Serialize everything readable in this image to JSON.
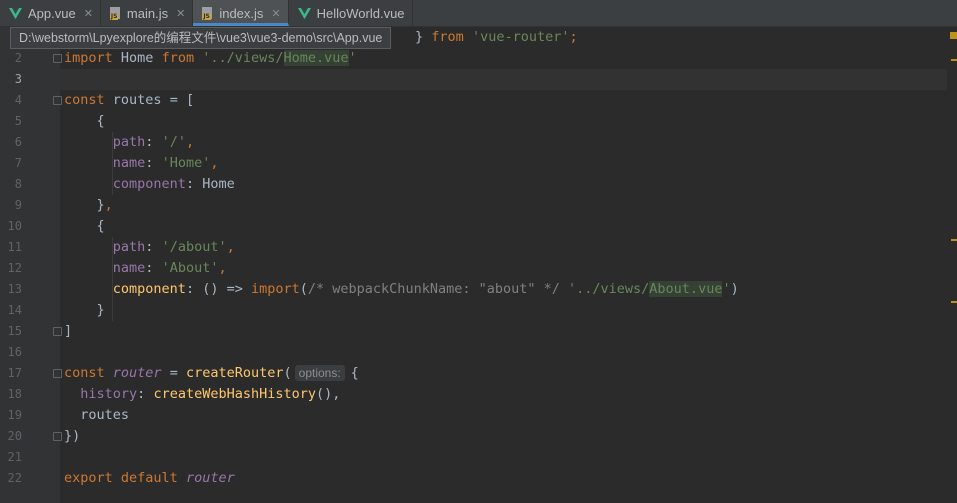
{
  "tabs": [
    {
      "label": "App.vue",
      "icon": "vue-icon"
    },
    {
      "label": "main.js",
      "icon": "js-file-icon"
    },
    {
      "label": "index.js",
      "icon": "js-file-icon",
      "active": true
    },
    {
      "label": "HelloWorld.vue",
      "icon": "vue-icon"
    }
  ],
  "js_badge": "JS",
  "tooltip": "D:\\webstorm\\Lpyexplore的编程文件\\vue3\\vue3-demo\\src\\App.vue",
  "editor": {
    "current_line": 3,
    "inlay_hint": "options:",
    "line_numbers": [
      "2",
      "3",
      "4",
      "5",
      "6",
      "7",
      "8",
      "9",
      "10",
      "11",
      "12",
      "13",
      "14",
      "15",
      "16",
      "17",
      "18",
      "19",
      "20",
      "21",
      "22"
    ],
    "lines": {
      "l1": {
        "brace": "}",
        "from": "from",
        "str": "'vue-router'",
        "semi": ";"
      },
      "l2": {
        "import": "import",
        "name": "Home",
        "from": "from",
        "str_a": "'../views/",
        "str_b": "Home.vue",
        "str_c": "'"
      },
      "l4": {
        "const": "const",
        "name": "routes",
        "rest": " = ["
      },
      "l5": {
        "text": "{"
      },
      "l6": {
        "key": "path",
        "colon": ": ",
        "str": "'/'",
        "comma": ","
      },
      "l7": {
        "key": "name",
        "colon": ": ",
        "str": "'Home'",
        "comma": ","
      },
      "l8": {
        "key": "component",
        "colon": ": ",
        "value": "Home"
      },
      "l9": {
        "brace": "}",
        "comma": ","
      },
      "l10": {
        "text": "{"
      },
      "l11": {
        "key": "path",
        "colon": ": ",
        "str": "'/about'",
        "comma": ","
      },
      "l12": {
        "key": "name",
        "colon": ": ",
        "str": "'About'",
        "comma": ","
      },
      "l13": {
        "key": "component",
        "colon": ": ",
        "arrow": "() => ",
        "import": "import",
        "paren": "(",
        "comment": "/* webpackChunkName: \"about\" */",
        "str_a": "'../views/",
        "str_b": "About.vue",
        "str_c": "'",
        "close": ")"
      },
      "l14": {
        "text": "}"
      },
      "l15": {
        "text": "]"
      },
      "l17": {
        "const": "const",
        "name": "router",
        "eq": " = ",
        "fn": "createRouter",
        "paren": "(",
        "brace": "{"
      },
      "l18": {
        "key": "history",
        "colon": ": ",
        "fn": "createWebHashHistory",
        "rest": "(),"
      },
      "l19": {
        "text": "routes"
      },
      "l20": {
        "text": "})"
      },
      "l22": {
        "export": "export default",
        "name": "router"
      }
    }
  },
  "colors": {
    "keyword": "#cc7832",
    "string": "#6a8759",
    "property": "#9876aa",
    "function": "#ffc66d",
    "comment": "#808080",
    "marker": "#be9117"
  }
}
